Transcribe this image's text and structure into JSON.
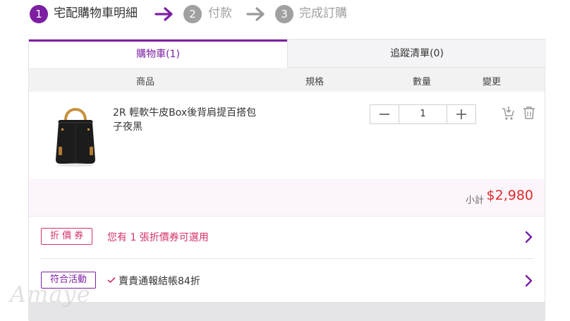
{
  "steps": [
    {
      "number": "1",
      "label": "宅配購物車明細"
    },
    {
      "number": "2",
      "label": "付款"
    },
    {
      "number": "3",
      "label": "完成訂購"
    }
  ],
  "tabs": {
    "cart": "購物車(1)",
    "wishlist": "追蹤清單(0)"
  },
  "columns": {
    "product": "商品",
    "spec": "規格",
    "qty": "數量",
    "change": "變更"
  },
  "item": {
    "name": "2R 輕軟牛皮Box後背肩提百搭包 子夜黑",
    "quantity": "1"
  },
  "subtotal": {
    "label": "小計",
    "amount": "$2,980"
  },
  "coupon": {
    "tag": "折 價 券",
    "text": "您有 1 張折價券可選用"
  },
  "promotion": {
    "tag": "符合活動",
    "text": "賣貴通報結帳84折"
  },
  "watermark": "Amaye",
  "colors": {
    "accent": "#7c1fa2",
    "coupon": "#d6306a",
    "price": "#e02a2a"
  },
  "icons": [
    "arrow-right-icon",
    "minus-icon",
    "plus-icon",
    "move-to-wishlist-icon",
    "trash-icon",
    "chevron-right-icon",
    "check-icon"
  ]
}
